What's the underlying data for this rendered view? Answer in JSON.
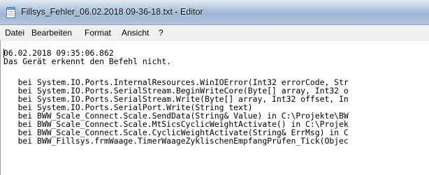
{
  "window": {
    "title": "Fillsys_Fehler_06.02.2018 09-36-18.txt - Editor",
    "app_icon": "notepad-icon"
  },
  "menu": {
    "items": [
      "Datei",
      "Bearbeiten",
      "Format",
      "Ansicht",
      "?"
    ]
  },
  "document": {
    "lines": [
      "06.02.2018 09:35:06.862",
      "Das Gerät erkennt den Befehl nicht.",
      "",
      "   bei System.IO.Ports.InternalResources.WinIOError(Int32 errorCode, Str",
      "   bei System.IO.Ports.SerialStream.BeginWriteCore(Byte[] array, Int32 o",
      "   bei System.IO.Ports.SerialStream.Write(Byte[] array, Int32 offset, In",
      "   bei System.IO.Ports.SerialPort.Write(String text)",
      "   bei BWW_Scale_Connect.Scale.SendData(String& Value) in C:\\Projekte\\BW",
      "   bei BWW_Scale_Connect.Scale.MtSicsCyclicWeightActivate() in C:\\Projek",
      "   bei BWW_Scale_Connect.Scale.CyclicWeightActivate(String& ErrMsg) in C",
      "   bei BWW_Fillsys.frmWaage.TimerWaageZyklischenEmpfangPrüfen_Tick(Objec"
    ]
  }
}
